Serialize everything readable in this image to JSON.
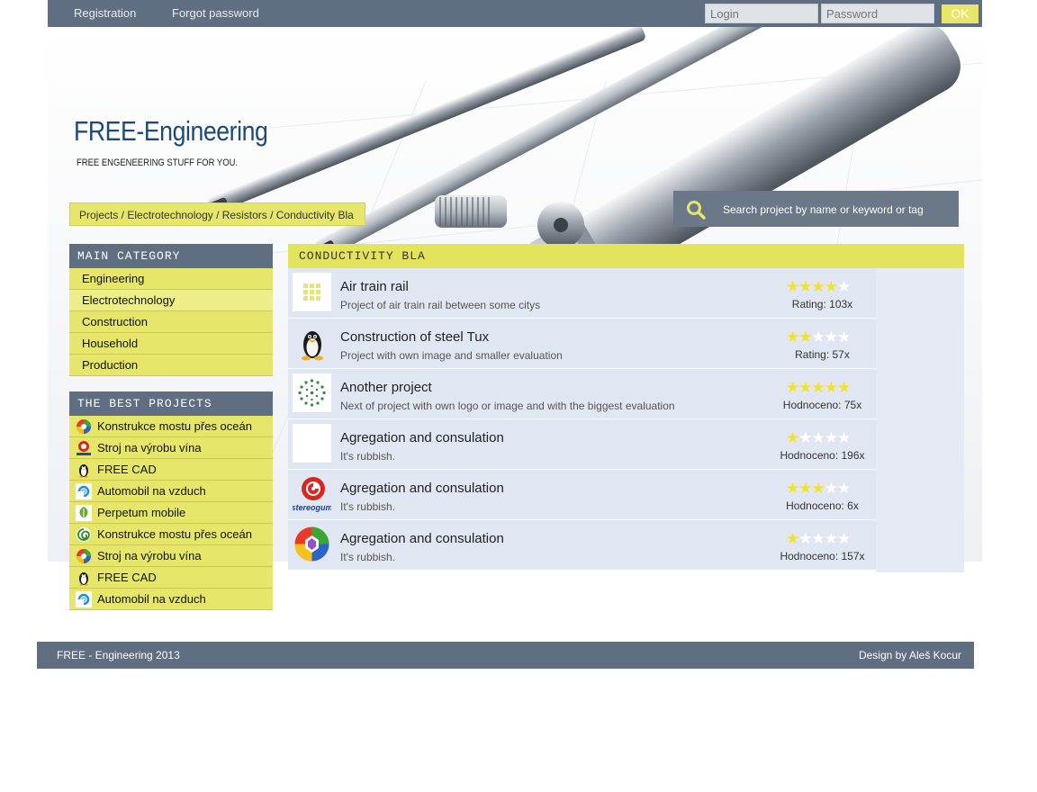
{
  "topbar": {
    "registration": "Registration",
    "forgot_password": "Forgot password",
    "login_placeholder": "Login",
    "password_placeholder": "Password",
    "ok_label": "OK"
  },
  "header": {
    "title": "FREE-Engineering",
    "tagline": "FREE ENGENEERING STUFF FOR YOU."
  },
  "breadcrumb": "Projects / Electrotechnology / Resistors / Conductivity Bla",
  "search": {
    "placeholder": "Search project by name or keyword or tag"
  },
  "sidebar": {
    "main_category_title": "MAIN CATEGORY",
    "categories": [
      {
        "label": "Engineering",
        "active": false
      },
      {
        "label": "Electrotechnology",
        "active": true
      },
      {
        "label": "Construction",
        "active": false
      },
      {
        "label": "Household",
        "active": false
      },
      {
        "label": "Production",
        "active": false
      }
    ],
    "best_title": "THE BEST PROJECTS",
    "best": [
      {
        "label": "Konstrukce mostu přes oceán",
        "icon": "colorful-ball-icon"
      },
      {
        "label": "Stroj na výrobu vína",
        "icon": "stereogum-logo-icon"
      },
      {
        "label": "FREE CAD",
        "icon": "penguin-icon"
      },
      {
        "label": "Automobil na vzduch",
        "icon": "wave-logo-icon"
      },
      {
        "label": "Perpetum mobile",
        "icon": "leaf-logo-icon"
      },
      {
        "label": "Konstrukce mostu přes oceán",
        "icon": "green-swirl-icon"
      },
      {
        "label": "Stroj na výrobu vína",
        "icon": "colorful-ball-icon"
      },
      {
        "label": "FREE CAD",
        "icon": "penguin-icon"
      },
      {
        "label": "Automobil na vzduch",
        "icon": "wave-logo-icon"
      }
    ]
  },
  "main": {
    "title": "CONDUCTIVITY BLA",
    "projects": [
      {
        "title": "Air train rail",
        "desc": "Project of air train rail between some citys",
        "rating": 4,
        "rating_text": "Rating: 103x",
        "icon": "grid-placeholder-icon"
      },
      {
        "title": "Construction of steel Tux",
        "desc": "Project with own image and smaller evaluation",
        "rating": 2,
        "rating_text": "Rating: 57x",
        "icon": "penguin-icon"
      },
      {
        "title": "Another project",
        "desc": "Next of project with own logo or image and with the biggest evaluation",
        "rating": 5,
        "rating_text": "Hodnoceno: 75x",
        "icon": "green-dots-logo-icon"
      },
      {
        "title": "Agregation and consulation",
        "desc": "It's rubbish.",
        "rating": 1,
        "rating_text": "Hodnoceno: 196x",
        "icon": "blank-image-icon"
      },
      {
        "title": "Agregation and consulation",
        "desc": "It's rubbish.",
        "rating": 3,
        "rating_text": "Hodnoceno: 6x",
        "icon": "stereogum-logo-icon"
      },
      {
        "title": "Agregation and consulation",
        "desc": "It's rubbish.",
        "rating": 1,
        "rating_text": "Hodnoceno: 157x",
        "icon": "colorful-ball-icon"
      }
    ],
    "stereogum_text": "stereogum"
  },
  "footer": {
    "left": "FREE - Engineering 2013",
    "right": "Design by Aleš Kocur"
  },
  "colors": {
    "bar": "#5f6e80",
    "accent_yellow": "#e6e66a",
    "title_blue": "#1c4a7a",
    "row_bg": "#e1e7f2",
    "star": "#f2e328"
  }
}
